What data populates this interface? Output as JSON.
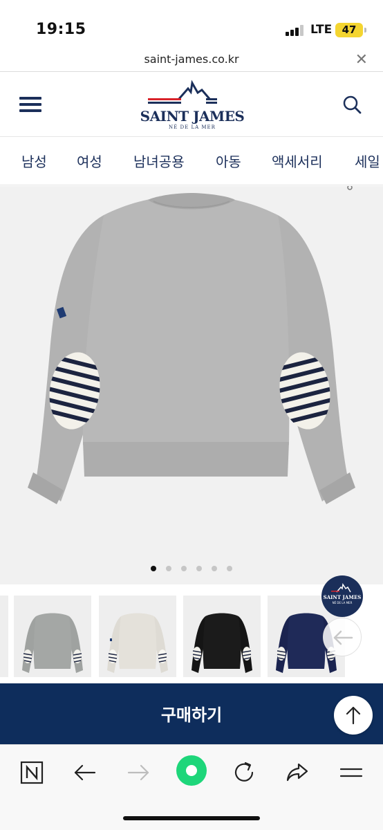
{
  "status_bar": {
    "time": "19:15",
    "network": "LTE",
    "battery": "47"
  },
  "url_bar": {
    "url": "saint-james.co.kr",
    "close_icon": "close-icon"
  },
  "header": {
    "brand_name": "SAINT JAMES",
    "brand_tagline": "NÉ DE LA MER",
    "menu_icon": "hamburger-menu-icon",
    "search_icon": "search-icon",
    "brand_color": "#1b2f5a"
  },
  "categories": [
    "남성",
    "여성",
    "남녀공용",
    "아동",
    "액세서리",
    "세일"
  ],
  "gallery": {
    "slide_count": 6,
    "active_slide": 1,
    "product_color": "#b0b0b0",
    "thumbnails": [
      {
        "color": "grey"
      },
      {
        "color": "ecru"
      },
      {
        "color": "black"
      },
      {
        "color": "navy"
      }
    ]
  },
  "badge": {
    "brand_name": "SAINT JAMES",
    "tagline": "NÉ DE LA MER"
  },
  "buy_button": {
    "label": "구매하기",
    "color": "#0e2d5c"
  },
  "browser_toolbar": {
    "icons": [
      "naver-n-icon",
      "back-arrow-icon",
      "forward-arrow-icon",
      "green-home-icon",
      "reload-icon",
      "share-icon",
      "menu-icon"
    ]
  }
}
